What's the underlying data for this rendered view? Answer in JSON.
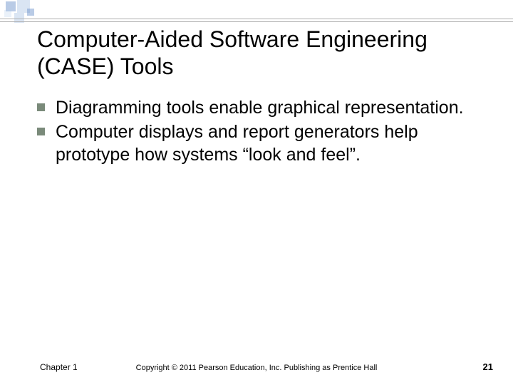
{
  "title": "Computer-Aided Software Engineering (CASE) Tools",
  "bullets": [
    "Diagramming tools enable graphical representation.",
    "Computer displays and report generators help prototype how systems “look and feel”."
  ],
  "footer": {
    "chapter": "Chapter 1",
    "copyright": "Copyright © 2011 Pearson Education, Inc. Publishing as Prentice Hall",
    "page": "21"
  }
}
